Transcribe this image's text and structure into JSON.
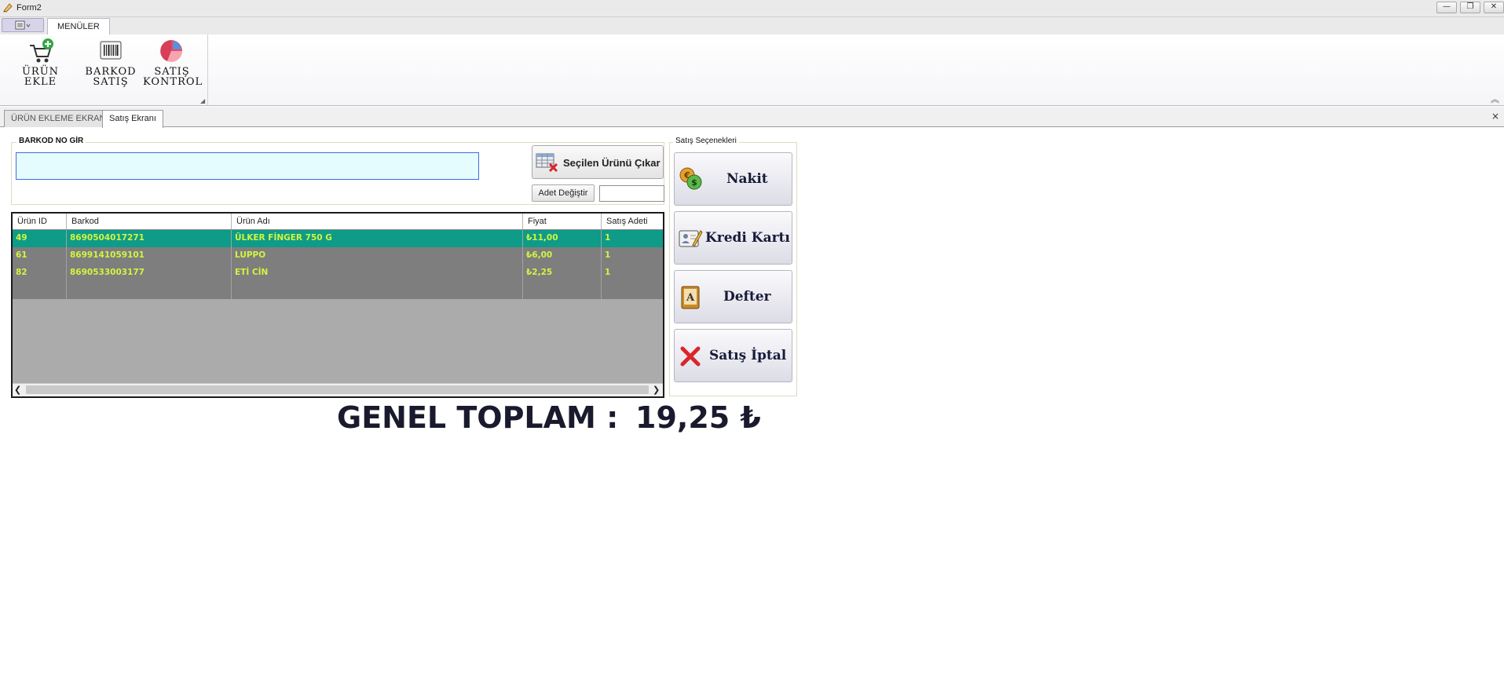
{
  "window": {
    "title": "Form2",
    "minimize_glyph": "—",
    "restore_glyph": "❐",
    "close_glyph": "✕"
  },
  "ribbon": {
    "tab": "MENÜLER",
    "buttons": [
      {
        "line1": "ÜRÜN EKLE",
        "line2": "",
        "icon": "cart-add-icon"
      },
      {
        "line1": "BARKOD",
        "line2": "SATIŞ",
        "icon": "barcode-icon"
      },
      {
        "line1": "SATIŞ",
        "line2": "KONTROL",
        "icon": "pie-chart-icon"
      }
    ]
  },
  "document_tabs": [
    "ÜRÜN EKLEME EKRANI",
    "Satış Ekranı"
  ],
  "document_close_glyph": "×",
  "barcode_panel": {
    "legend": "BARKOD NO GİR",
    "input_value": "",
    "remove_button": "Seçilen Ürünü Çıkar",
    "change_qty_button": "Adet Değiştir",
    "qty_value": ""
  },
  "grid": {
    "columns": [
      "Ürün ID",
      "Barkod",
      "Ürün Adı",
      "Fiyat",
      "Satış Adeti"
    ],
    "rows": [
      [
        "49",
        "8690504017271",
        "ÜLKER FİNGER 750 G",
        "₺11,00",
        "1"
      ],
      [
        "61",
        "8699141059101",
        "LUPPO",
        "₺6,00",
        "1"
      ],
      [
        "82",
        "8690533003177",
        "ETİ CİN",
        "₺2,25",
        "1"
      ]
    ],
    "selected_row": 0,
    "selected_color": "#0e9b88",
    "row_color": "#7e7e7e",
    "cell_text_color": "#d1f53f"
  },
  "payment_panel": {
    "legend": "Satış Seçenekleri",
    "buttons": [
      {
        "label": "Nakit",
        "icon": "coins-icon"
      },
      {
        "label": "Kredi Kartı",
        "icon": "card-pen-icon"
      },
      {
        "label": "Defter",
        "icon": "book-icon"
      },
      {
        "label": "Satış İptal",
        "icon": "cancel-icon"
      }
    ]
  },
  "total": {
    "label": "GENEL TOPLAM :",
    "value": "19,25 ₺"
  }
}
